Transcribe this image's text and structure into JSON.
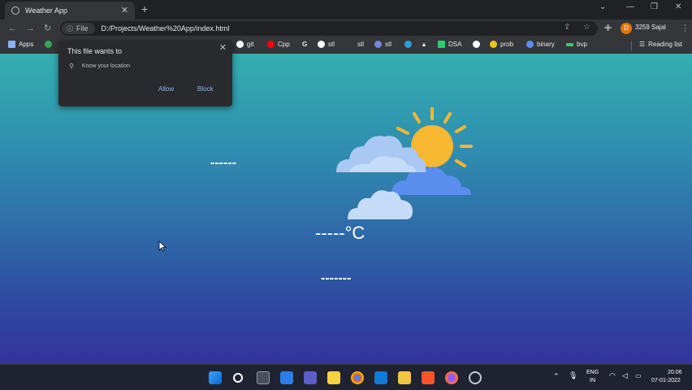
{
  "browser": {
    "tab_title": "Weather App",
    "tab_close": "✕",
    "new_tab": "+",
    "window_controls": [
      "⌄",
      "—",
      "❐",
      "✕"
    ],
    "address": {
      "chip_icon": "info-icon",
      "chip_label": "File",
      "url": "D:/Projects/Weather%20App/index.html"
    },
    "profile": {
      "initial": "D",
      "name": "3259 Sajal"
    },
    "bookmarks": [
      {
        "label": "Apps",
        "icon": "apps-grid-icon",
        "color": "#8ab4f8"
      },
      {
        "label": "",
        "icon": "drive-icon",
        "color": "#34a853"
      },
      {
        "label": "git",
        "icon": "github-icon",
        "color": "#ffffff"
      },
      {
        "label": "Cpp",
        "icon": "youtube-icon",
        "color": "#ff0000"
      },
      {
        "label": "",
        "icon": "google-icon",
        "color": "#ffffff"
      },
      {
        "label": "stl",
        "icon": "github-icon",
        "color": "#ffffff"
      },
      {
        "label": "stl",
        "icon": "blank-icon",
        "color": "#35363a"
      },
      {
        "label": "stl",
        "icon": "discord-icon",
        "color": "#7289da"
      },
      {
        "label": "",
        "icon": "telegram-icon",
        "color": "#2aa1da"
      },
      {
        "label": "",
        "icon": "triangle-icon",
        "color": "#dddddd"
      },
      {
        "label": "DSA",
        "icon": "plus-icon",
        "color": "#2ecc71"
      },
      {
        "label": "",
        "icon": "globe-icon",
        "color": "#ffffff"
      },
      {
        "label": "prob",
        "icon": "settings-icon",
        "color": "#f1c40f"
      },
      {
        "label": "binary",
        "icon": "cloud-icon",
        "color": "#5b8def"
      },
      {
        "label": "bvp",
        "icon": "bar-icon",
        "color": "#2ecc71"
      }
    ],
    "reading_list": "Reading list"
  },
  "popup": {
    "title": "This file wants to",
    "permission": "Know your location",
    "allow": "Allow",
    "block": "Block",
    "close": "✕"
  },
  "app": {
    "city": "------",
    "temperature": "-----°C",
    "description": "-------"
  },
  "taskbar": {
    "apps": [
      "windows-start-icon",
      "search-icon",
      "task-view-icon",
      "widgets-icon",
      "teams-chat-icon",
      "notes-icon",
      "chrome-icon",
      "mail-icon",
      "file-explorer-icon",
      "brave-icon",
      "firefox-icon",
      "clock-icon"
    ],
    "language": "ENG",
    "region": "IN",
    "time": "20:06",
    "date": "07-01-2022"
  },
  "colors": {
    "page_top": "#34aeb0",
    "page_bottom": "#33339c",
    "link_blue": "#8ab4f8",
    "sun": "#f7b731"
  }
}
